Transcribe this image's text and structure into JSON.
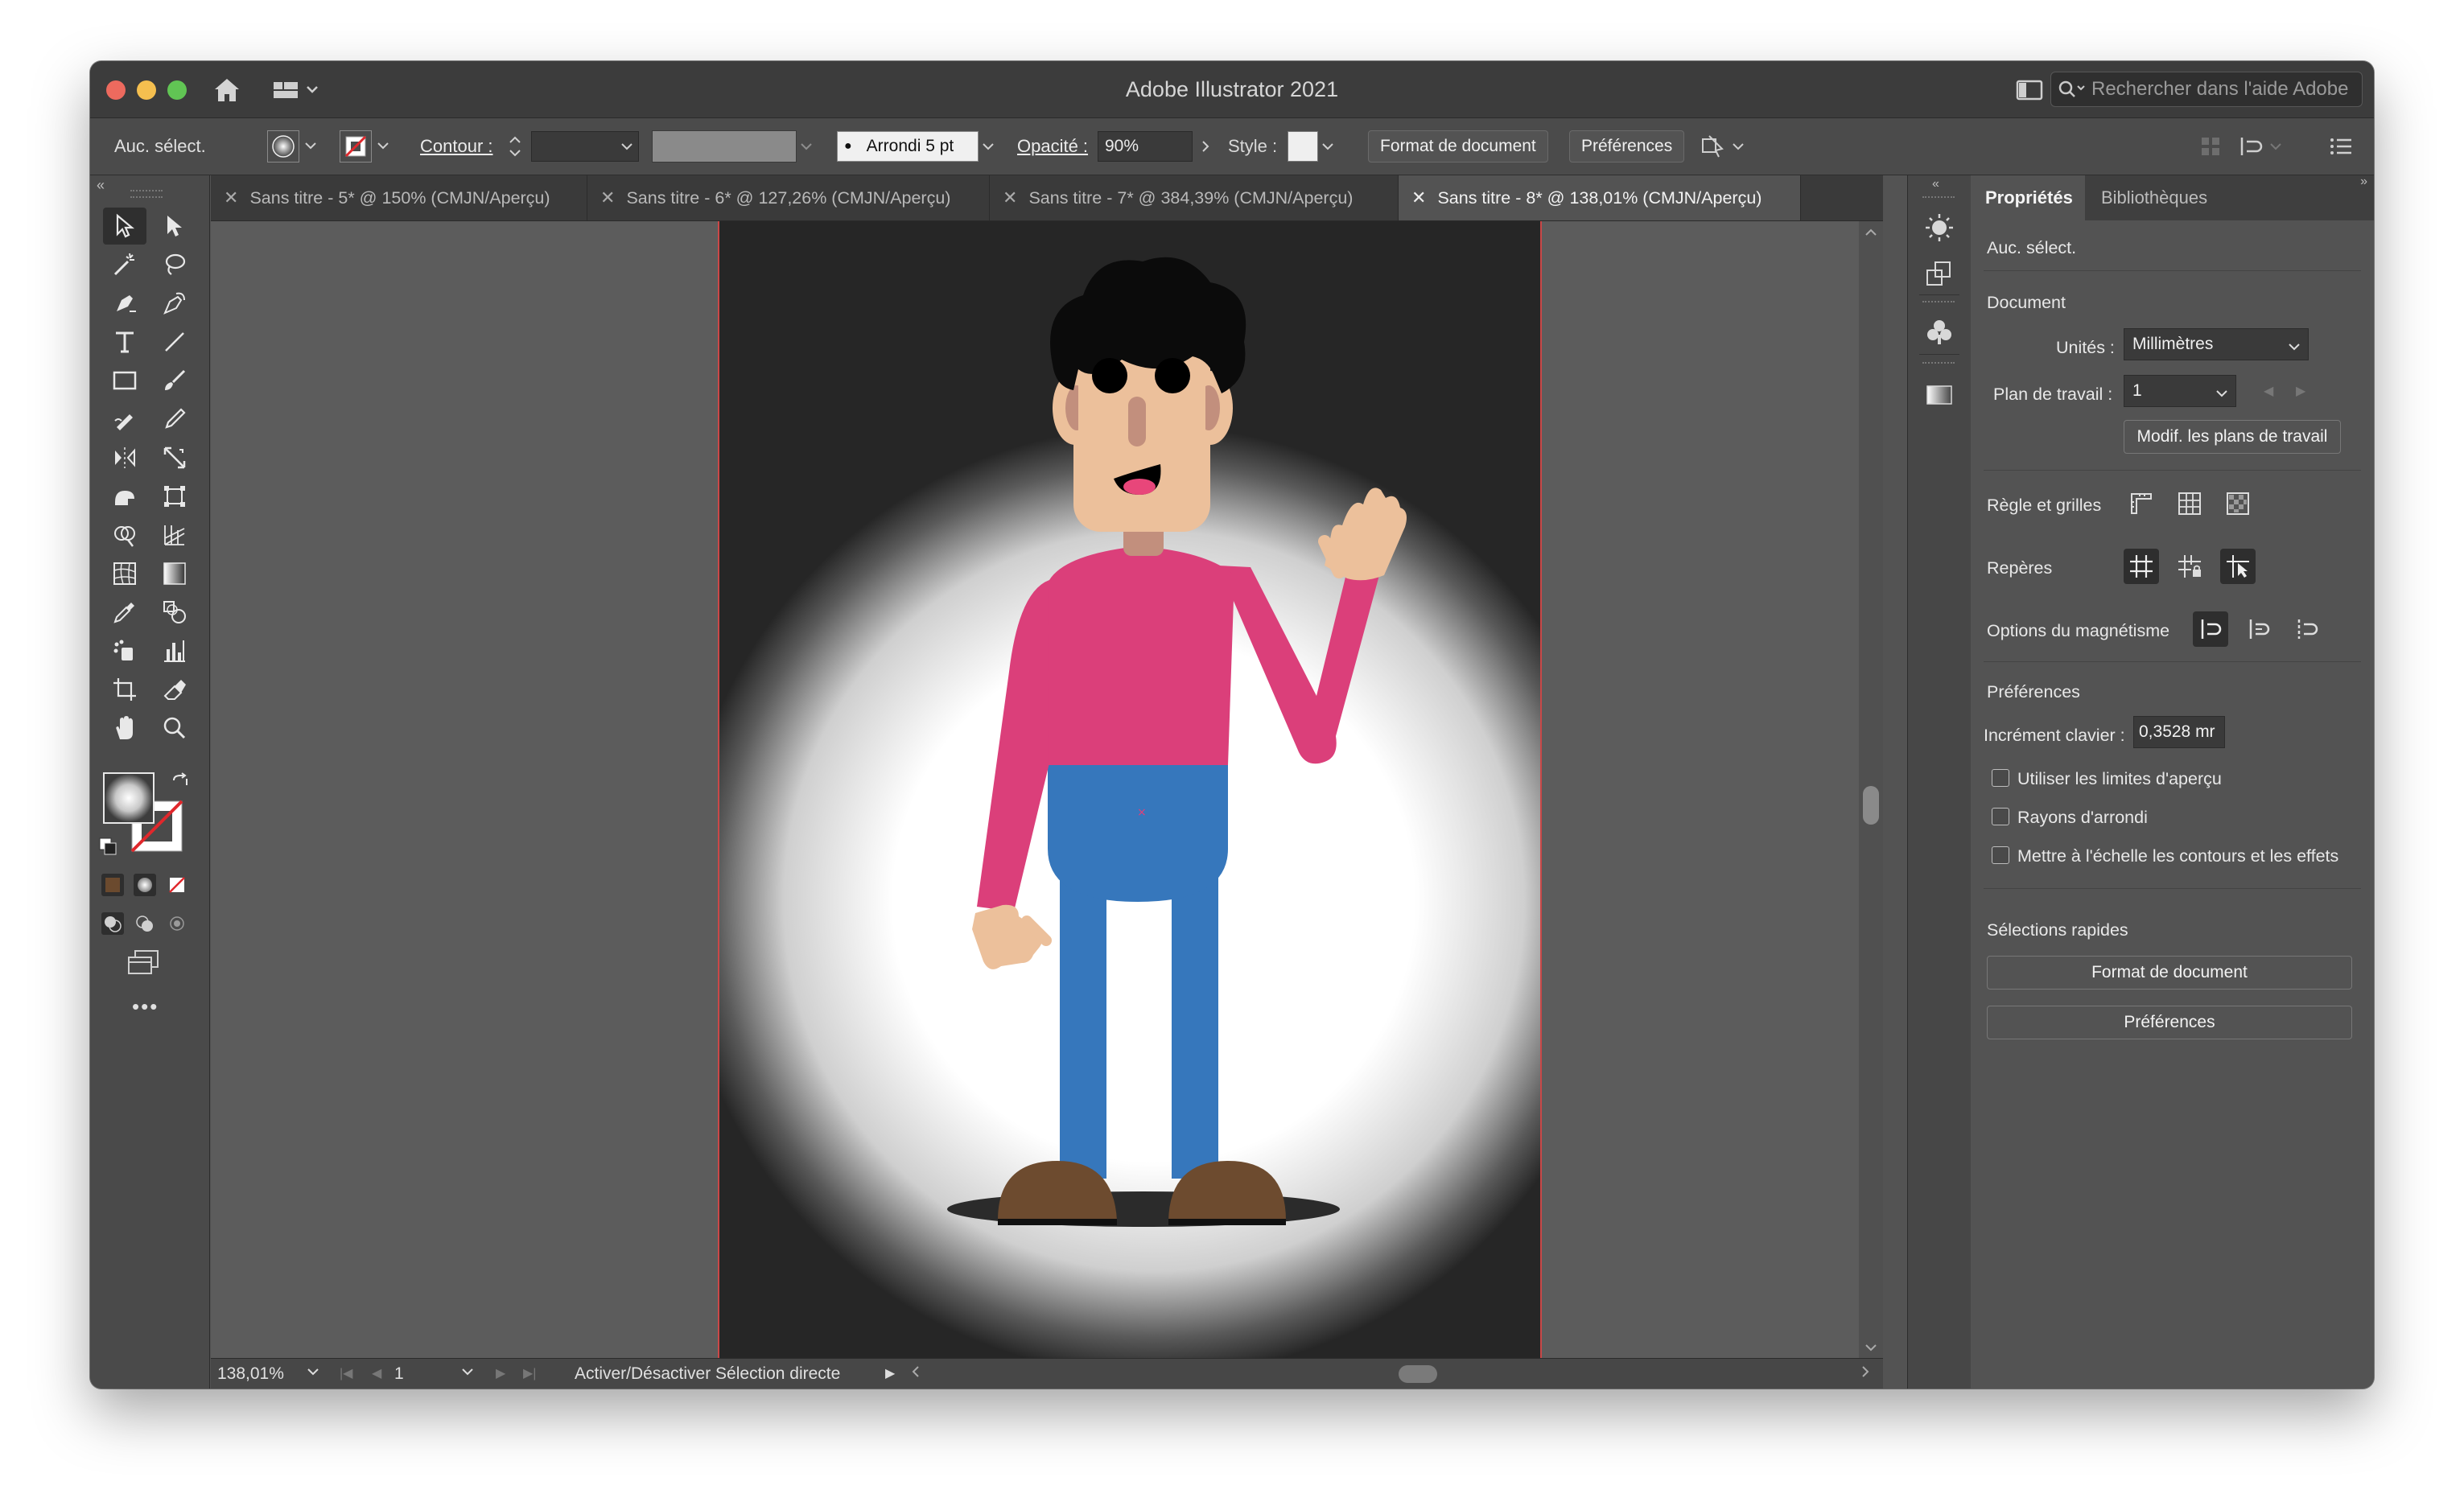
{
  "app": {
    "title": "Adobe Illustrator 2021"
  },
  "search": {
    "placeholder": "Rechercher dans l'aide Adobe"
  },
  "controlbar": {
    "selection": "Auc. sélect.",
    "contour_label": "Contour :",
    "brush": "Arrondi 5 pt",
    "opacity_label": "Opacité :",
    "opacity_value": "90%",
    "style_label": "Style :",
    "doc_format_button": "Format de document",
    "preferences_button": "Préférences"
  },
  "tabs": [
    {
      "label": "Sans titre - 5* @ 150% (CMJN/Aperçu)",
      "active": false
    },
    {
      "label": "Sans titre - 6* @ 127,26% (CMJN/Aperçu)",
      "active": false
    },
    {
      "label": "Sans titre - 7* @ 384,39% (CMJN/Aperçu)",
      "active": false
    },
    {
      "label": "Sans titre - 8* @ 138,01% (CMJN/Aperçu)",
      "active": true
    }
  ],
  "statusbar": {
    "zoom": "138,01%",
    "artboard_number": "1",
    "message": "Activer/Désactiver Sélection directe"
  },
  "panel": {
    "tab_properties": "Propriétés",
    "tab_libraries": "Bibliothèques",
    "selection": "Auc. sélect.",
    "document_heading": "Document",
    "units_label": "Unités :",
    "units_value": "Millimètres",
    "artboard_label": "Plan de travail :",
    "artboard_value": "1",
    "edit_artboards_button": "Modif. les plans de travail",
    "rulers_grids_label": "Règle et grilles",
    "guides_label": "Repères",
    "snap_options_label": "Options du magnétisme",
    "preferences_heading": "Préférences",
    "keyboard_increment_label": "Incrément clavier :",
    "keyboard_increment_value": "0,3528 mr",
    "checkboxes": [
      {
        "label": "Utiliser les limites d'aperçu",
        "checked": false
      },
      {
        "label": "Rayons d'arrondi",
        "checked": false
      },
      {
        "label": "Mettre à l'échelle les contours et les effets",
        "checked": false
      }
    ],
    "quick_selections_heading": "Sélections rapides",
    "doc_format_button": "Format de document",
    "preferences_button": "Préférences"
  },
  "colors": {
    "window_bg": "#535353",
    "artboard_bg": "#262626",
    "spotlight": "#ffffff",
    "hair": "#000000",
    "skin": "#ecc09b",
    "nose": "#c28f7d",
    "mouth": "#e8467a",
    "shirt": "#db3f7a",
    "pants": "#3677bc",
    "shoes": "#6d4b2f",
    "artboard_border": "#c94848"
  }
}
